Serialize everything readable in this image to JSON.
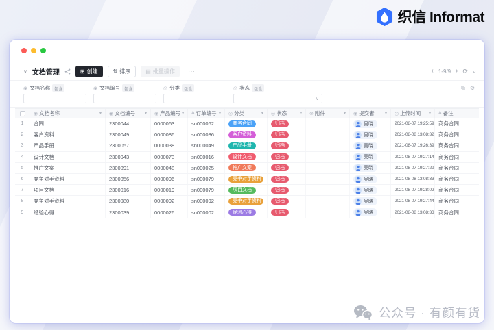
{
  "brand": {
    "name": "织信 Informat",
    "icon_color": "#3370ff"
  },
  "watermark": {
    "text": "公众号 · 有颜有货"
  },
  "window": {
    "traffic_lights": [
      "#fc5b57",
      "#fdbc2e",
      "#28c840"
    ],
    "toolbar": {
      "collapse_icon": "∨",
      "title": "文档管理",
      "create_icon": "⊞",
      "create": "创建",
      "sort_icon": "⇅",
      "sort": "排序",
      "batch_icon": "▤",
      "batch": "批量操作",
      "more": "⋯",
      "prev": "‹",
      "pagination": "1-9/9",
      "next": "›",
      "refresh_icon": "⟳",
      "search_icon": "⌕"
    },
    "filters": {
      "contains_tag": "包含",
      "select_chevron": "∨",
      "expand_icon": "⧉",
      "gear_icon": "⚙",
      "items": [
        {
          "icon": "◉",
          "label": "文档名称",
          "type": "input",
          "value": ""
        },
        {
          "icon": "◉",
          "label": "文档编号",
          "type": "input",
          "value": ""
        },
        {
          "icon": "◎",
          "label": "分类",
          "type": "select",
          "value": ""
        },
        {
          "icon": "◎",
          "label": "状态",
          "type": "select",
          "value": ""
        }
      ]
    },
    "table": {
      "sort_caret": "▾",
      "columns": [
        {
          "icon": "◉",
          "label": "文档名称"
        },
        {
          "icon": "◉",
          "label": "文档编号"
        },
        {
          "icon": "◉",
          "label": "产品编号"
        },
        {
          "icon": "A",
          "label": "订单编号"
        },
        {
          "icon": "◎",
          "label": "分类"
        },
        {
          "icon": "◎",
          "label": "状态"
        },
        {
          "icon": "⊘",
          "label": "附件"
        },
        {
          "icon": "◉",
          "label": "提交者"
        },
        {
          "icon": "◷",
          "label": "上传时间"
        },
        {
          "icon": "A",
          "label": "备注"
        }
      ],
      "rows": [
        {
          "no": "1",
          "name": "合同",
          "doc_no": "2300044",
          "product_no": "0000063",
          "order_no": "sn000062",
          "category": "商务合同",
          "status": "归档",
          "attachment": "",
          "submitter": "吴晓",
          "time": "2021-08-07 19:25:59",
          "remark": "商务合同"
        },
        {
          "no": "2",
          "name": "客户资料",
          "doc_no": "2300049",
          "product_no": "0000086",
          "order_no": "sn000086",
          "category": "客户资料",
          "status": "归档",
          "attachment": "",
          "submitter": "吴晓",
          "time": "2021-08-08 13:08:32",
          "remark": "商务合同"
        },
        {
          "no": "3",
          "name": "产品手册",
          "doc_no": "2300057",
          "product_no": "0000038",
          "order_no": "sn000049",
          "category": "产品手册",
          "status": "归档",
          "attachment": "",
          "submitter": "吴晓",
          "time": "2021-08-07 19:26:39",
          "remark": "商务合同"
        },
        {
          "no": "4",
          "name": "设计文档",
          "doc_no": "2300043",
          "product_no": "0000073",
          "order_no": "sn000016",
          "category": "设计文档",
          "status": "归档",
          "attachment": "",
          "submitter": "吴晓",
          "time": "2021-08-07 19:27:14",
          "remark": "商务合同"
        },
        {
          "no": "5",
          "name": "推广文案",
          "doc_no": "2300091",
          "product_no": "0000048",
          "order_no": "sn000025",
          "category": "推广文案",
          "status": "归档",
          "attachment": "",
          "submitter": "吴晓",
          "time": "2021-08-07 19:27:29",
          "remark": "商务合同"
        },
        {
          "no": "6",
          "name": "竞争对手资料",
          "doc_no": "2300056",
          "product_no": "0000096",
          "order_no": "sn000079",
          "category": "竞争对手资料",
          "status": "归档",
          "attachment": "",
          "submitter": "吴晓",
          "time": "2021-08-08 13:08:33",
          "remark": "商务合同"
        },
        {
          "no": "7",
          "name": "项目文档",
          "doc_no": "2300016",
          "product_no": "0000019",
          "order_no": "sn000079",
          "category": "项目文档",
          "status": "归档",
          "attachment": "",
          "submitter": "吴晓",
          "time": "2021-08-07 19:28:02",
          "remark": "商务合同"
        },
        {
          "no": "8",
          "name": "竞争对手资料",
          "doc_no": "2300080",
          "product_no": "0000092",
          "order_no": "sn000092",
          "category": "竞争对手资料",
          "status": "归档",
          "attachment": "",
          "submitter": "吴晓",
          "time": "2021-08-07 19:27:44",
          "remark": "商务合同"
        },
        {
          "no": "9",
          "name": "经验心得",
          "doc_no": "2300039",
          "product_no": "0000026",
          "order_no": "sn000002",
          "category": "经验心得",
          "status": "归档",
          "attachment": "",
          "submitter": "吴晓",
          "time": "2021-08-08 13:08:33",
          "remark": "商务合同"
        }
      ]
    }
  },
  "colors": {
    "status": "#e75a6e",
    "category": {
      "商务合同": "#4ba2f7",
      "客户资料": "#d45fd8",
      "产品手册": "#20b6ae",
      "设计文档": "#f05b6e",
      "推广文案": "#f07a5a",
      "竞争对手资料": "#e9a13b",
      "项目文档": "#55bb5e",
      "经验心得": "#9c7be4"
    }
  }
}
